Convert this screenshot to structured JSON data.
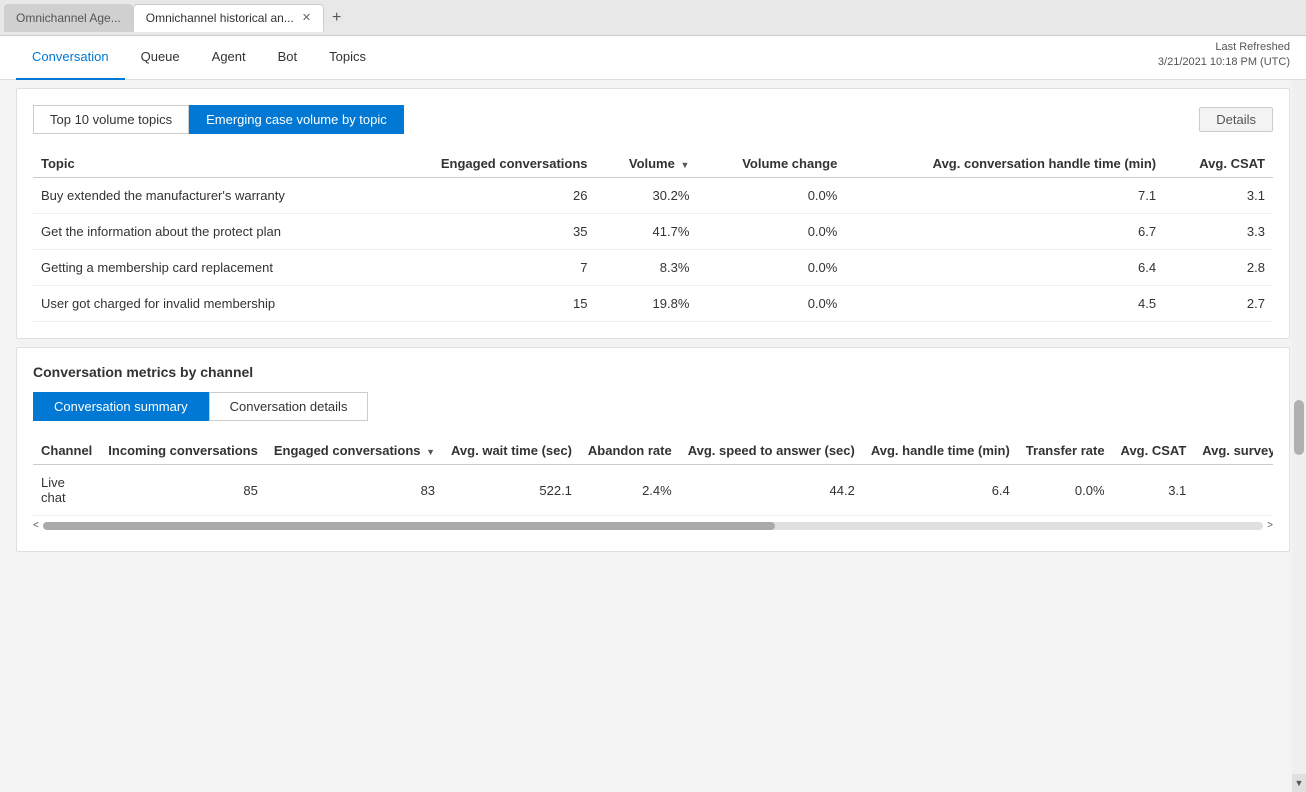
{
  "browser": {
    "tabs": [
      {
        "id": "tab1",
        "label": "Omnichannel Age...",
        "active": false
      },
      {
        "id": "tab2",
        "label": "Omnichannel historical an...",
        "active": true
      }
    ],
    "add_tab_label": "+"
  },
  "nav": {
    "items": [
      {
        "id": "conversation",
        "label": "Conversation",
        "active": true
      },
      {
        "id": "queue",
        "label": "Queue",
        "active": false
      },
      {
        "id": "agent",
        "label": "Agent",
        "active": false
      },
      {
        "id": "bot",
        "label": "Bot",
        "active": false
      },
      {
        "id": "topics",
        "label": "Topics",
        "active": false
      }
    ],
    "last_refreshed_label": "Last Refreshed",
    "last_refreshed_value": "3/21/2021 10:18 PM (UTC)"
  },
  "top_topics_panel": {
    "tabs": [
      {
        "id": "top10",
        "label": "Top 10 volume topics",
        "active": false
      },
      {
        "id": "emerging",
        "label": "Emerging case volume by topic",
        "active": true
      }
    ],
    "details_button": "Details",
    "table": {
      "columns": [
        {
          "id": "topic",
          "label": "Topic",
          "align": "left"
        },
        {
          "id": "engaged",
          "label": "Engaged conversations",
          "align": "right"
        },
        {
          "id": "volume",
          "label": "Volume",
          "align": "right",
          "sortable": true
        },
        {
          "id": "volume_change",
          "label": "Volume change",
          "align": "right"
        },
        {
          "id": "avg_handle",
          "label": "Avg. conversation handle time (min)",
          "align": "right"
        },
        {
          "id": "avg_csat",
          "label": "Avg. CSAT",
          "align": "right"
        }
      ],
      "rows": [
        {
          "topic": "Buy extended the manufacturer's warranty",
          "engaged": "26",
          "volume": "30.2%",
          "volume_change": "0.0%",
          "avg_handle": "7.1",
          "avg_csat": "3.1"
        },
        {
          "topic": "Get the information about the protect plan",
          "engaged": "35",
          "volume": "41.7%",
          "volume_change": "0.0%",
          "avg_handle": "6.7",
          "avg_csat": "3.3"
        },
        {
          "topic": "Getting a membership card replacement",
          "engaged": "7",
          "volume": "8.3%",
          "volume_change": "0.0%",
          "avg_handle": "6.4",
          "avg_csat": "2.8"
        },
        {
          "topic": "User got charged for invalid membership",
          "engaged": "15",
          "volume": "19.8%",
          "volume_change": "0.0%",
          "avg_handle": "4.5",
          "avg_csat": "2.7"
        }
      ]
    }
  },
  "metrics_panel": {
    "section_title": "Conversation metrics by channel",
    "sub_tabs": [
      {
        "id": "summary",
        "label": "Conversation summary",
        "active": true
      },
      {
        "id": "details",
        "label": "Conversation details",
        "active": false
      }
    ],
    "table": {
      "columns": [
        {
          "id": "channel",
          "label": "Channel",
          "align": "left"
        },
        {
          "id": "incoming",
          "label": "Incoming conversations",
          "align": "right"
        },
        {
          "id": "engaged",
          "label": "Engaged conversations",
          "align": "right",
          "sortable": true
        },
        {
          "id": "avg_wait",
          "label": "Avg. wait time (sec)",
          "align": "right"
        },
        {
          "id": "abandon_rate",
          "label": "Abandon rate",
          "align": "right"
        },
        {
          "id": "avg_speed",
          "label": "Avg. speed to answer (sec)",
          "align": "right"
        },
        {
          "id": "avg_handle",
          "label": "Avg. handle time (min)",
          "align": "right"
        },
        {
          "id": "transfer_rate",
          "label": "Transfer rate",
          "align": "right"
        },
        {
          "id": "avg_csat",
          "label": "Avg. CSAT",
          "align": "right"
        },
        {
          "id": "avg_survey",
          "label": "Avg. survey se",
          "align": "right"
        }
      ],
      "rows": [
        {
          "channel": "Live chat",
          "incoming": "85",
          "engaged": "83",
          "avg_wait": "522.1",
          "abandon_rate": "2.4%",
          "avg_speed": "44.2",
          "avg_handle": "6.4",
          "transfer_rate": "0.0%",
          "avg_csat": "3.1",
          "avg_survey": ""
        }
      ]
    }
  }
}
